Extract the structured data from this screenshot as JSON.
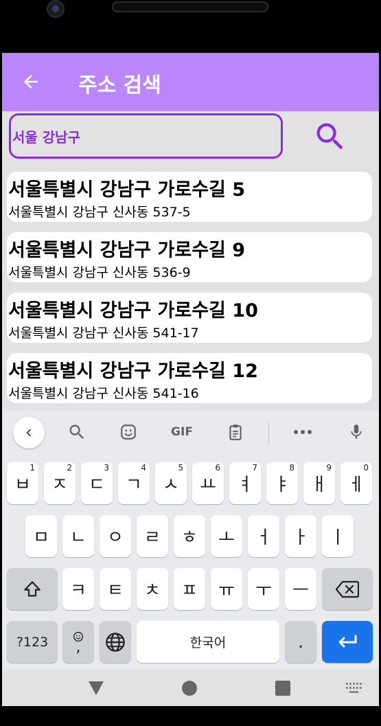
{
  "app": {
    "title": "주소 검색"
  },
  "search": {
    "value": "서울 강남구",
    "placeholder": ""
  },
  "results": [
    {
      "road": "서울특별시 강남구 가로수길 5",
      "jibun": "서울특별시 강남구 신사동 537-5"
    },
    {
      "road": "서울특별시 강남구 가로수길 9",
      "jibun": "서울특별시 강남구 신사동 536-9"
    },
    {
      "road": "서울특별시 강남구 가로수길 10",
      "jibun": "서울특별시 강남구 신사동 541-17"
    },
    {
      "road": "서울특별시 강남구 가로수길 12",
      "jibun": "서울특별시 강남구 신사동 541-16"
    }
  ],
  "keyboard": {
    "toolbar": {
      "gif_label": "GIF"
    },
    "row1": [
      {
        "key": "ㅂ",
        "hint": "1"
      },
      {
        "key": "ㅈ",
        "hint": "2"
      },
      {
        "key": "ㄷ",
        "hint": "3"
      },
      {
        "key": "ㄱ",
        "hint": "4"
      },
      {
        "key": "ㅅ",
        "hint": "5"
      },
      {
        "key": "ㅛ",
        "hint": "6"
      },
      {
        "key": "ㅕ",
        "hint": "7"
      },
      {
        "key": "ㅑ",
        "hint": "8"
      },
      {
        "key": "ㅐ",
        "hint": "9"
      },
      {
        "key": "ㅔ",
        "hint": "0"
      }
    ],
    "row2": [
      "ㅁ",
      "ㄴ",
      "ㅇ",
      "ㄹ",
      "ㅎ",
      "ㅗ",
      "ㅓ",
      "ㅏ",
      "ㅣ"
    ],
    "row3": [
      "ㅋ",
      "ㅌ",
      "ㅊ",
      "ㅍ",
      "ㅠ",
      "ㅜ",
      "ㅡ"
    ],
    "symbols_label": "?123",
    "emoji_comma_label": ",",
    "space_label": "한국어",
    "period_label": "."
  },
  "colors": {
    "appbar": "#bb86fc",
    "accent": "#8a2be2",
    "enter_key": "#1a73e8",
    "background": "#e2e2e2"
  }
}
